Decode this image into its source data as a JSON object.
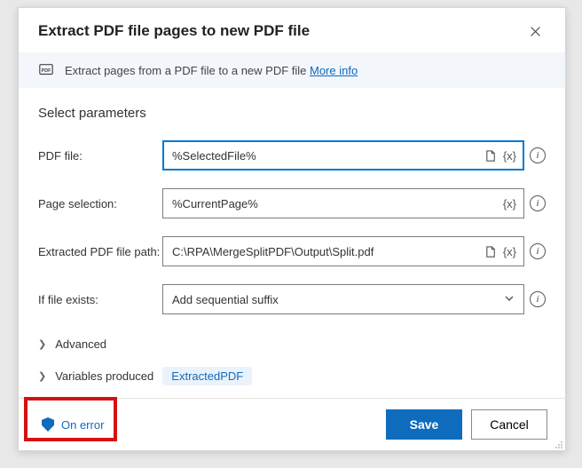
{
  "dialog": {
    "title": "Extract PDF file pages to new PDF file",
    "info_text": "Extract pages from a PDF file to a new PDF file ",
    "more_info": "More info",
    "section_heading": "Select parameters"
  },
  "fields": {
    "pdf_file": {
      "label": "PDF file:",
      "value": "%SelectedFile%"
    },
    "page_selection": {
      "label": "Page selection:",
      "value": "%CurrentPage%"
    },
    "extracted_path": {
      "label": "Extracted PDF file path:",
      "value": "C:\\RPA\\MergeSplitPDF\\Output\\Split.pdf"
    },
    "if_exists": {
      "label": "If file exists:",
      "value": "Add sequential suffix"
    }
  },
  "expanders": {
    "advanced": "Advanced",
    "variables_produced": "Variables produced",
    "produced_chip": "ExtractedPDF"
  },
  "footer": {
    "on_error": "On error",
    "save": "Save",
    "cancel": "Cancel"
  },
  "tokens": {
    "var": "{x}",
    "info": "i"
  }
}
